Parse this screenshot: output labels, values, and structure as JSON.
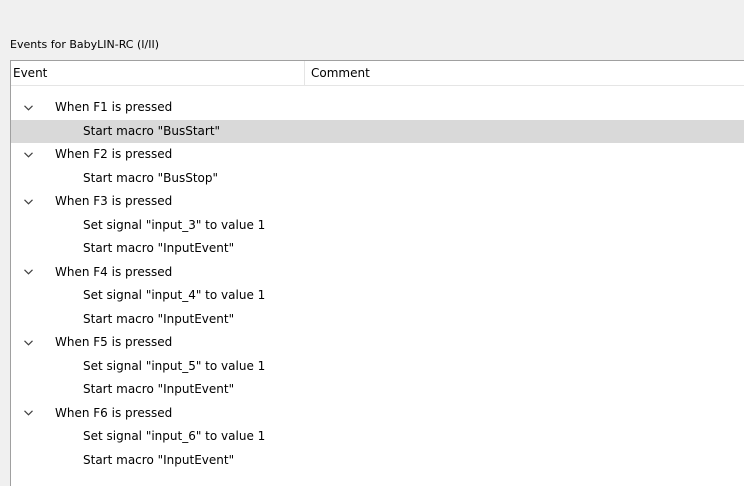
{
  "group": {
    "title": "Events for BabyLIN-RC (I/II)"
  },
  "columns": {
    "event": "Event",
    "comment": "Comment"
  },
  "events": [
    {
      "label": "When F1 is pressed",
      "expanded": true,
      "actions": [
        {
          "label": "Start macro \"BusStart\"",
          "selected": true
        }
      ]
    },
    {
      "label": "When F2 is pressed",
      "expanded": true,
      "actions": [
        {
          "label": "Start macro \"BusStop\""
        }
      ]
    },
    {
      "label": "When F3 is pressed",
      "expanded": true,
      "actions": [
        {
          "label": "Set signal \"input_3\" to value 1"
        },
        {
          "label": "Start macro \"InputEvent\""
        }
      ]
    },
    {
      "label": "When F4 is pressed",
      "expanded": true,
      "actions": [
        {
          "label": "Set signal \"input_4\" to value 1"
        },
        {
          "label": "Start macro \"InputEvent\""
        }
      ]
    },
    {
      "label": "When F5 is pressed",
      "expanded": true,
      "actions": [
        {
          "label": "Set signal \"input_5\" to value 1"
        },
        {
          "label": "Start macro \"InputEvent\""
        }
      ]
    },
    {
      "label": "When F6 is pressed",
      "expanded": true,
      "actions": [
        {
          "label": "Set signal \"input_6\" to value 1"
        },
        {
          "label": "Start macro \"InputEvent\""
        }
      ]
    }
  ],
  "icons": {
    "expand": "chevron-down-icon"
  },
  "colors": {
    "selection": "#d9d9d9",
    "panel": "#ffffff",
    "window": "#f0f0f0"
  }
}
